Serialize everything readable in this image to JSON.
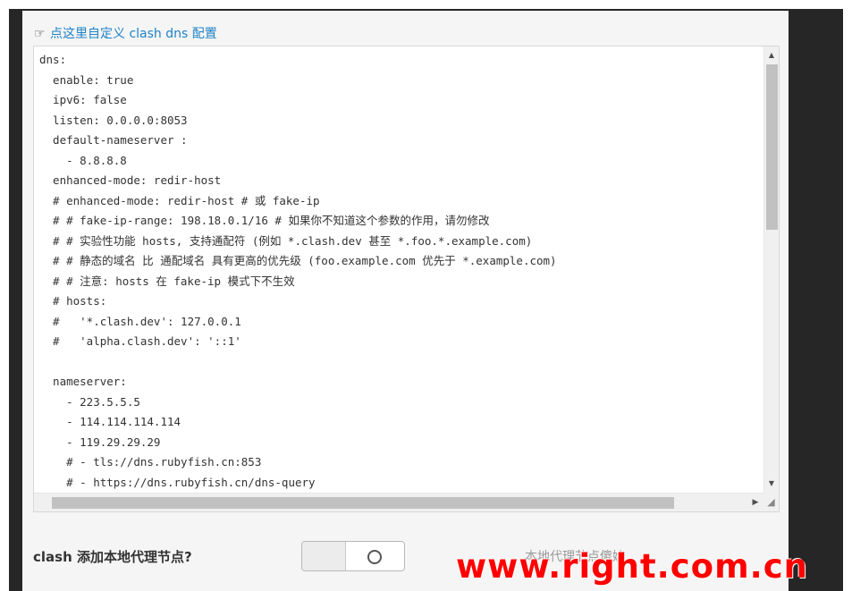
{
  "link": {
    "icon": "hand-pointer-icon",
    "text": "点这里自定义 clash dns 配置"
  },
  "editor": {
    "lines": [
      "dns:",
      "  enable: true",
      "  ipv6: false",
      "  listen: 0.0.0.0:8053",
      "  default-nameserver :",
      "    - 8.8.8.8",
      "  enhanced-mode: redir-host",
      "  # enhanced-mode: redir-host # 或 fake-ip",
      "  # # fake-ip-range: 198.18.0.1/16 # 如果你不知道这个参数的作用，请勿修改",
      "  # # 实验性功能 hosts, 支持通配符 (例如 *.clash.dev 甚至 *.foo.*.example.com)",
      "  # # 静态的域名 比 通配域名 具有更高的优先级 (foo.example.com 优先于 *.example.com)",
      "  # # 注意: hosts 在 fake-ip 模式下不生效",
      "  # hosts:",
      "  #   '*.clash.dev': 127.0.0.1",
      "  #   'alpha.clash.dev': '::1'",
      "",
      "  nameserver:",
      "    - 223.5.5.5",
      "    - 114.114.114.114",
      "    - 119.29.29.29",
      "    # - tls://dns.rubyfish.cn:853",
      "    # - https://dns.rubyfish.cn/dns-query"
    ],
    "vscroll_position": 0.0,
    "hscroll_position": 0.0
  },
  "option": {
    "label": "clash 添加本地代理节点?",
    "toggle_state": "off",
    "helper": "本地代理节点傻娃"
  },
  "watermark": "www.right.com.cn"
}
